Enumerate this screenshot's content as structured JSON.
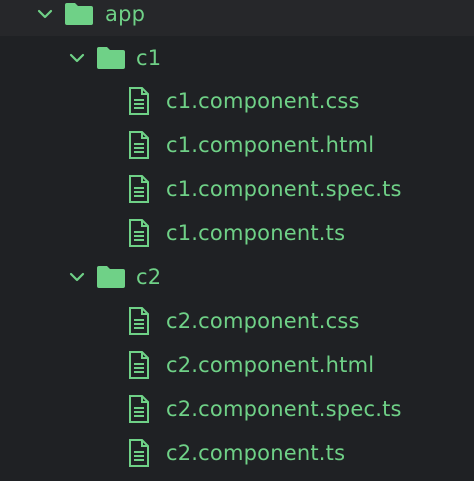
{
  "colors": {
    "background": "#1f2124",
    "text": "#6fd187",
    "icon": "#6fd187"
  },
  "tree": {
    "root": {
      "label": "app",
      "icon": "folder-icon",
      "expanded": true
    },
    "folders": [
      {
        "label": "c1",
        "icon": "folder-icon",
        "expanded": true,
        "files": [
          {
            "label": "c1.component.css",
            "icon": "file-icon"
          },
          {
            "label": "c1.component.html",
            "icon": "file-icon"
          },
          {
            "label": "c1.component.spec.ts",
            "icon": "file-icon"
          },
          {
            "label": "c1.component.ts",
            "icon": "file-icon"
          }
        ]
      },
      {
        "label": "c2",
        "icon": "folder-icon",
        "expanded": true,
        "files": [
          {
            "label": "c2.component.css",
            "icon": "file-icon"
          },
          {
            "label": "c2.component.html",
            "icon": "file-icon"
          },
          {
            "label": "c2.component.spec.ts",
            "icon": "file-icon"
          },
          {
            "label": "c2.component.ts",
            "icon": "file-icon"
          }
        ]
      }
    ]
  }
}
